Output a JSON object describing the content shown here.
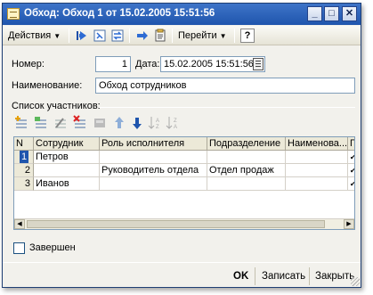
{
  "window": {
    "title": "Обход: Обход 1 от 15.02.2005 15:51:56",
    "controls": {
      "minimize": "_",
      "maximize": "□",
      "close": "✕"
    }
  },
  "toolbar": {
    "actions_label": "Действия",
    "goto_label": "Перейти",
    "help_label": "?"
  },
  "form": {
    "number_label": "Номер:",
    "number_value": "1",
    "date_label": "Дата:",
    "date_value": "15.02.2005 15:51:56",
    "name_label": "Наименование:",
    "name_value": "Обход сотрудников"
  },
  "participants": {
    "title": "Список участников:",
    "columns": [
      "N",
      "Сотрудник",
      "Роль исполнителя",
      "Подразделение",
      "Наименова...",
      "П"
    ],
    "rows": [
      {
        "n": "1",
        "employee": "Петров",
        "role": "",
        "department": "",
        "name": ""
      },
      {
        "n": "2",
        "employee": "",
        "role": "Руководитель отдела",
        "department": "Отдел продаж",
        "name": ""
      },
      {
        "n": "3",
        "employee": "Иванов",
        "role": "",
        "department": "",
        "name": ""
      }
    ]
  },
  "completed": {
    "label": "Завершен",
    "checked": false
  },
  "footer": {
    "ok_label": "OK",
    "save_label": "Записать",
    "close_label": "Закрыть"
  }
}
